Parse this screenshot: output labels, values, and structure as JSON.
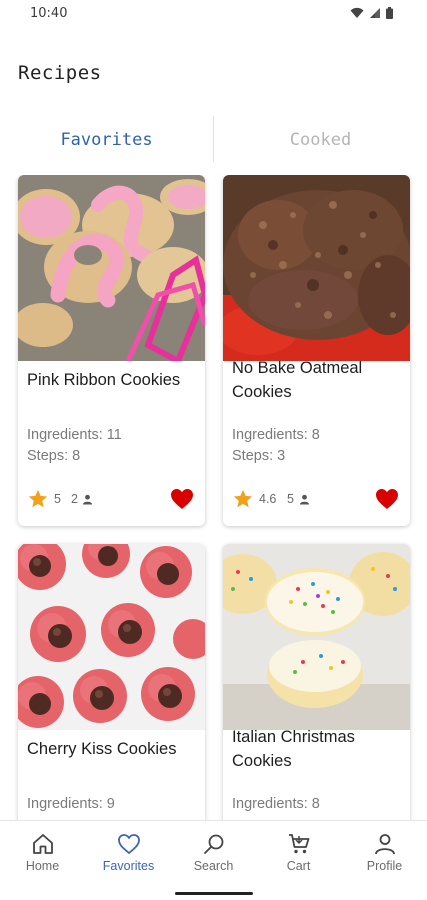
{
  "status_bar": {
    "time": "10:40"
  },
  "header": {
    "title": "Recipes"
  },
  "tabs": [
    {
      "label": "Favorites",
      "active": true
    },
    {
      "label": "Cooked",
      "active": false
    }
  ],
  "recipes": [
    {
      "title": "Pink Ribbon Cookies",
      "ingredients": "Ingredients: 11",
      "steps": "Steps: 8",
      "rating": "5",
      "cooks": "2",
      "favorite": true
    },
    {
      "title": "No Bake Oatmeal Cookies",
      "ingredients": "Ingredients: 8",
      "steps": "Steps: 3",
      "rating": "4.6",
      "cooks": "5",
      "favorite": true
    },
    {
      "title": "Cherry Kiss Cookies",
      "ingredients": "Ingredients: 9",
      "steps": "",
      "rating": "",
      "cooks": "",
      "favorite": true
    },
    {
      "title": "Italian Christmas Cookies",
      "ingredients": "Ingredients: 8",
      "steps": "",
      "rating": "",
      "cooks": "",
      "favorite": true
    }
  ],
  "bottom_nav": [
    {
      "label": "Home",
      "icon": "home-icon",
      "active": false
    },
    {
      "label": "Favorites",
      "icon": "heart-icon",
      "active": true
    },
    {
      "label": "Search",
      "icon": "search-icon",
      "active": false
    },
    {
      "label": "Cart",
      "icon": "cart-icon",
      "active": false
    },
    {
      "label": "Profile",
      "icon": "profile-icon",
      "active": false
    }
  ],
  "colors": {
    "accent": "#2f62b0",
    "heart": "#d90000",
    "star": "#f0a21b"
  }
}
